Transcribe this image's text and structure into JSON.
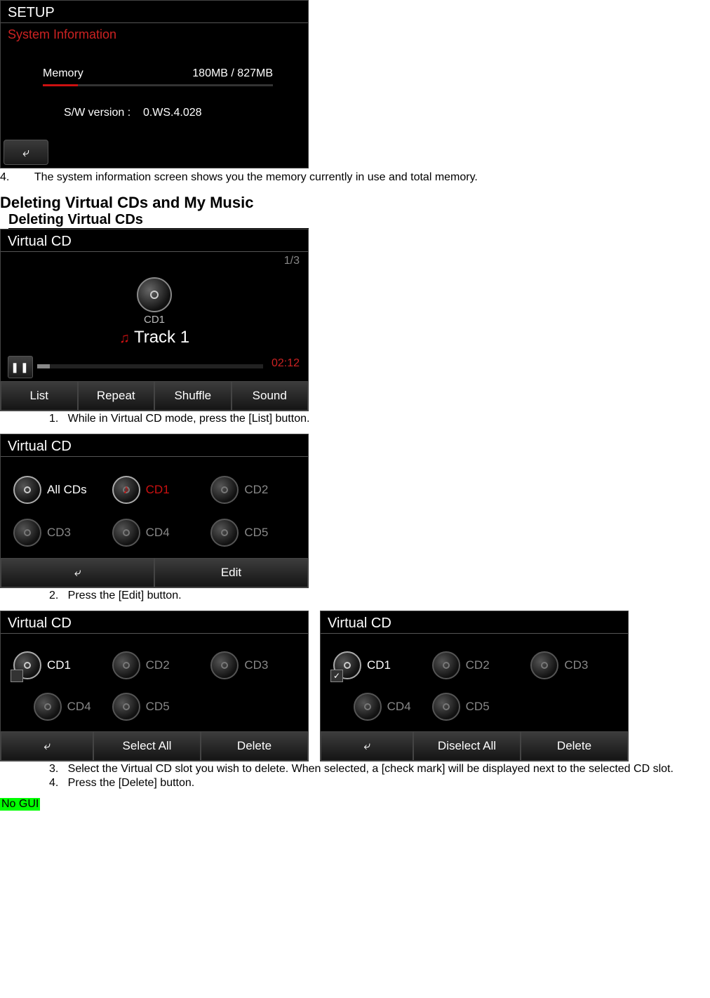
{
  "setup": {
    "title": "SETUP",
    "subtitle": "System Information",
    "memory_label": "Memory",
    "memory_value": "180MB / 827MB",
    "sw_label": "S/W version :",
    "sw_value": "0.WS.4.028",
    "back_glyph": "⤶"
  },
  "step4_text": "4.        The system information screen shows you the memory currently in use and total memory.",
  "h2": "Deleting Virtual CDs and My Music",
  "h3": "Deleting Virtual CDs",
  "player": {
    "title": "Virtual CD",
    "counter": "1/3",
    "cd_label": "CD1",
    "track_label": "Track  1",
    "time": "02:12",
    "pause_glyph": "❚❚",
    "buttons": {
      "list": "List",
      "repeat": "Repeat",
      "shuffle": "Shuffle",
      "sound": "Sound"
    }
  },
  "step1": "1.   While in Virtual CD mode, press the [List] button.",
  "list": {
    "title": "Virtual CD",
    "all": "All CDs",
    "cd1": "CD1",
    "cd2": "CD2",
    "cd3": "CD3",
    "cd4": "CD4",
    "cd5": "CD5",
    "back_glyph": "⤶",
    "edit": "Edit"
  },
  "step2": "2.   Press the [Edit] button.",
  "editA": {
    "title": "Virtual CD",
    "cd1": "CD1",
    "cd2": "CD2",
    "cd3": "CD3",
    "cd4": "CD4",
    "cd5": "CD5",
    "back_glyph": "⤶",
    "select_all": "Select All",
    "delete": "Delete"
  },
  "editB": {
    "title": "Virtual CD",
    "cd1": "CD1",
    "cd2": "CD2",
    "cd3": "CD3",
    "cd4": "CD4",
    "cd5": "CD5",
    "back_glyph": "⤶",
    "diselect_all": "Diselect All",
    "delete": "Delete",
    "check_glyph": "✓"
  },
  "step3": "3.   Select the Virtual CD slot you wish to delete. When selected, a [check mark] will be displayed next to the selected CD slot.",
  "step4b": "4.   Press the [Delete] button.",
  "no_gui": "No GUI"
}
